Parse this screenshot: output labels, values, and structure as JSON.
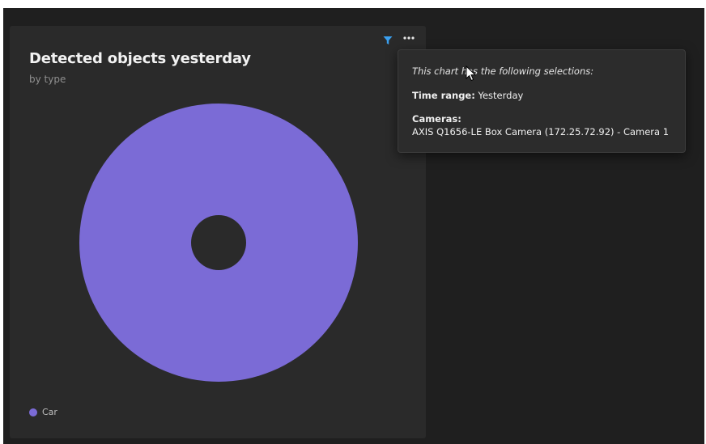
{
  "card": {
    "title": "Detected objects yesterday",
    "subtitle": "by type",
    "filter_icon": "filter-icon",
    "more_icon": "more-options-icon"
  },
  "chart_data": {
    "type": "pie",
    "style": "donut",
    "categories": [
      "Car"
    ],
    "values": [
      100
    ],
    "colors": [
      "#7b6bd6"
    ],
    "legend_placement": "bottom-left"
  },
  "legend": {
    "items": [
      {
        "label": "Car",
        "color": "#7b6bd6"
      }
    ]
  },
  "tooltip": {
    "intro": "This chart has the following selections:",
    "time_range_label": "Time range:",
    "time_range_value": "Yesterday",
    "cameras_label": "Cameras:",
    "cameras_value": "AXIS Q1656-LE Box Camera (172.25.72.92) - Camera 1"
  },
  "colors": {
    "background": "#1f1f1f",
    "card": "#2a2a2a",
    "accent_filter": "#3aa0f0",
    "slice": "#7b6bd6"
  }
}
